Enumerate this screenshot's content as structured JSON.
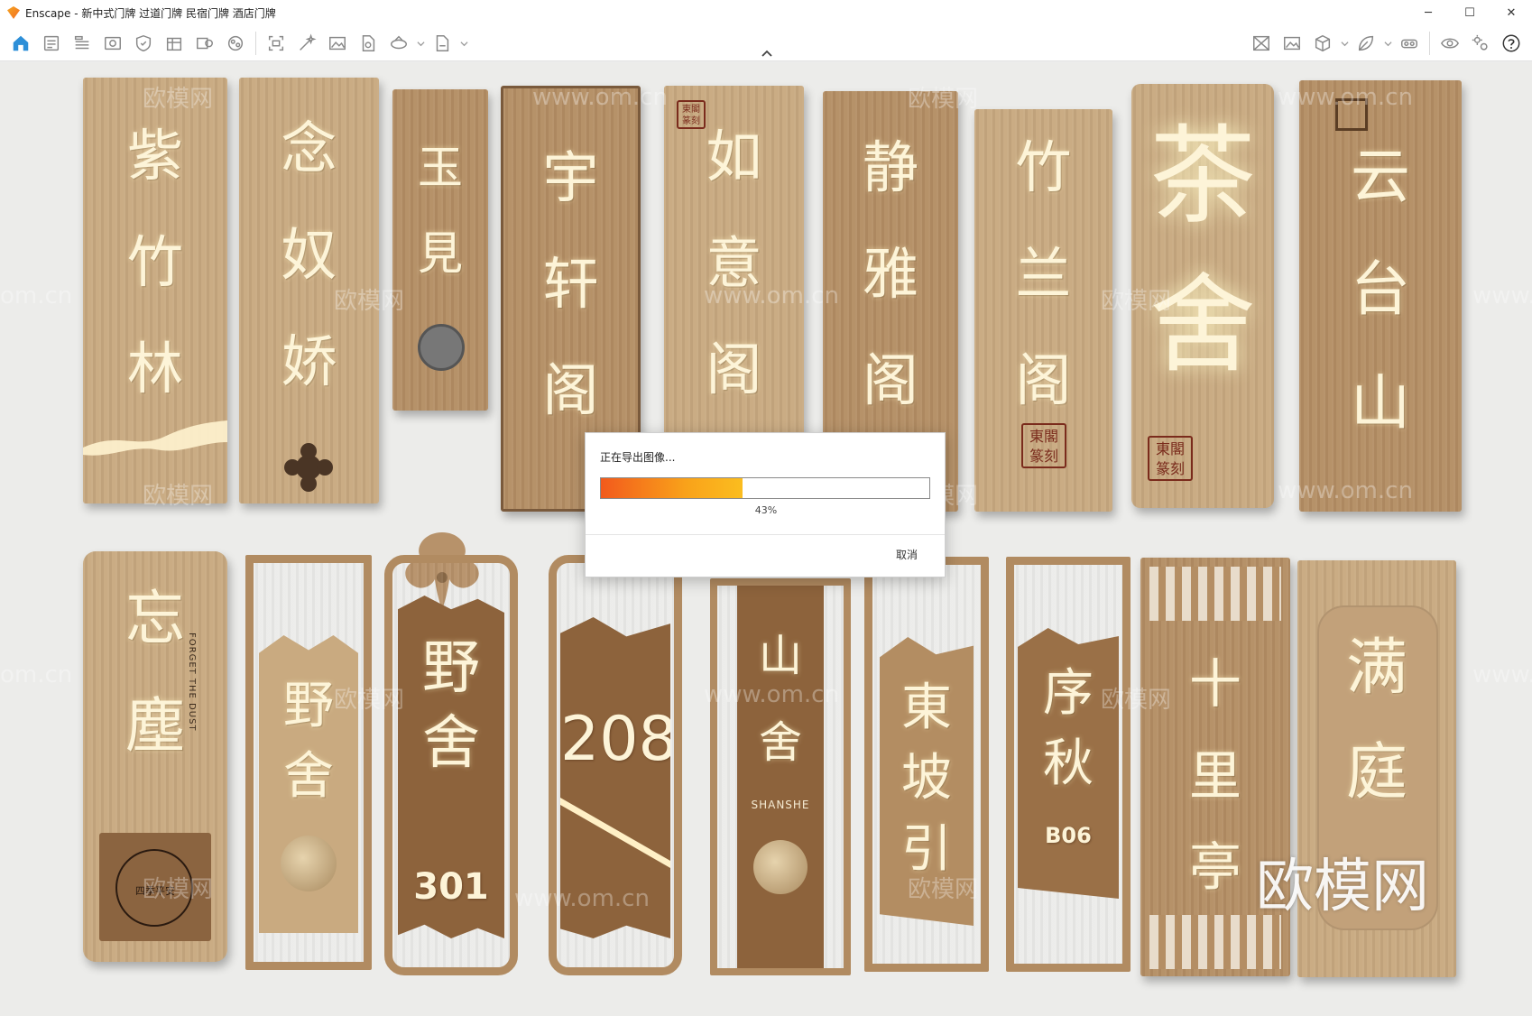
{
  "window": {
    "title": "Enscape - 新中式门牌 过道门牌 民宿门牌 酒店门牌",
    "controls": {
      "minimize": "─",
      "maximize": "☐",
      "close": "✕"
    }
  },
  "toolbar": {
    "left_icons": [
      "home-icon",
      "views-icon",
      "bim-icon",
      "visual-settings-icon",
      "safe-frame-icon",
      "asset-library-icon",
      "material-editor-icon",
      "atmosphere-icon",
      "screenshot-icon",
      "batch-render-icon",
      "render-image-icon",
      "export-exe-icon",
      "panorama-icon",
      "export-file-icon"
    ],
    "right_icons": [
      "capture-icon",
      "gallery-icon",
      "cube-icon",
      "leaf-icon",
      "vr-headset-icon",
      "eye-icon",
      "settings-icon",
      "help-icon"
    ]
  },
  "export_dialog": {
    "title": "正在导出图像...",
    "progress": 43,
    "progress_label": "43%",
    "cancel_label": "取消"
  },
  "viewport": {
    "signs_top": [
      {
        "text": "紫\n竹\n林"
      },
      {
        "text": "念\n奴\n娇"
      },
      {
        "text": "玉\n見"
      },
      {
        "text": "宇\n轩\n阁"
      },
      {
        "text": "如\n意\n阁"
      },
      {
        "text": "静\n雅\n阁"
      },
      {
        "text": "竹\n兰\n阁"
      },
      {
        "text": "茶\n舍"
      },
      {
        "text": "云\n台\n山"
      }
    ],
    "signs_bottom": [
      {
        "text": "忘\n塵",
        "side_text": "FORGET THE DUST",
        "stamp": "四季平安"
      },
      {
        "text": "野\n舍"
      },
      {
        "text": "野\n舍",
        "number": "301"
      },
      {
        "text": "",
        "number": "208"
      },
      {
        "text": "山\n舍",
        "sub": "SHANSHE"
      },
      {
        "text": "東\n坡\n引"
      },
      {
        "text": "序\n秋",
        "number": "B06"
      },
      {
        "text": "十\n里\n亭"
      },
      {
        "text": "满\n庭"
      }
    ],
    "seal_text": "東閣\n篆刻",
    "watermarks": [
      "欧模网",
      "www.om.cn",
      "om.cn",
      "www."
    ],
    "brand_watermark": "欧模网"
  }
}
